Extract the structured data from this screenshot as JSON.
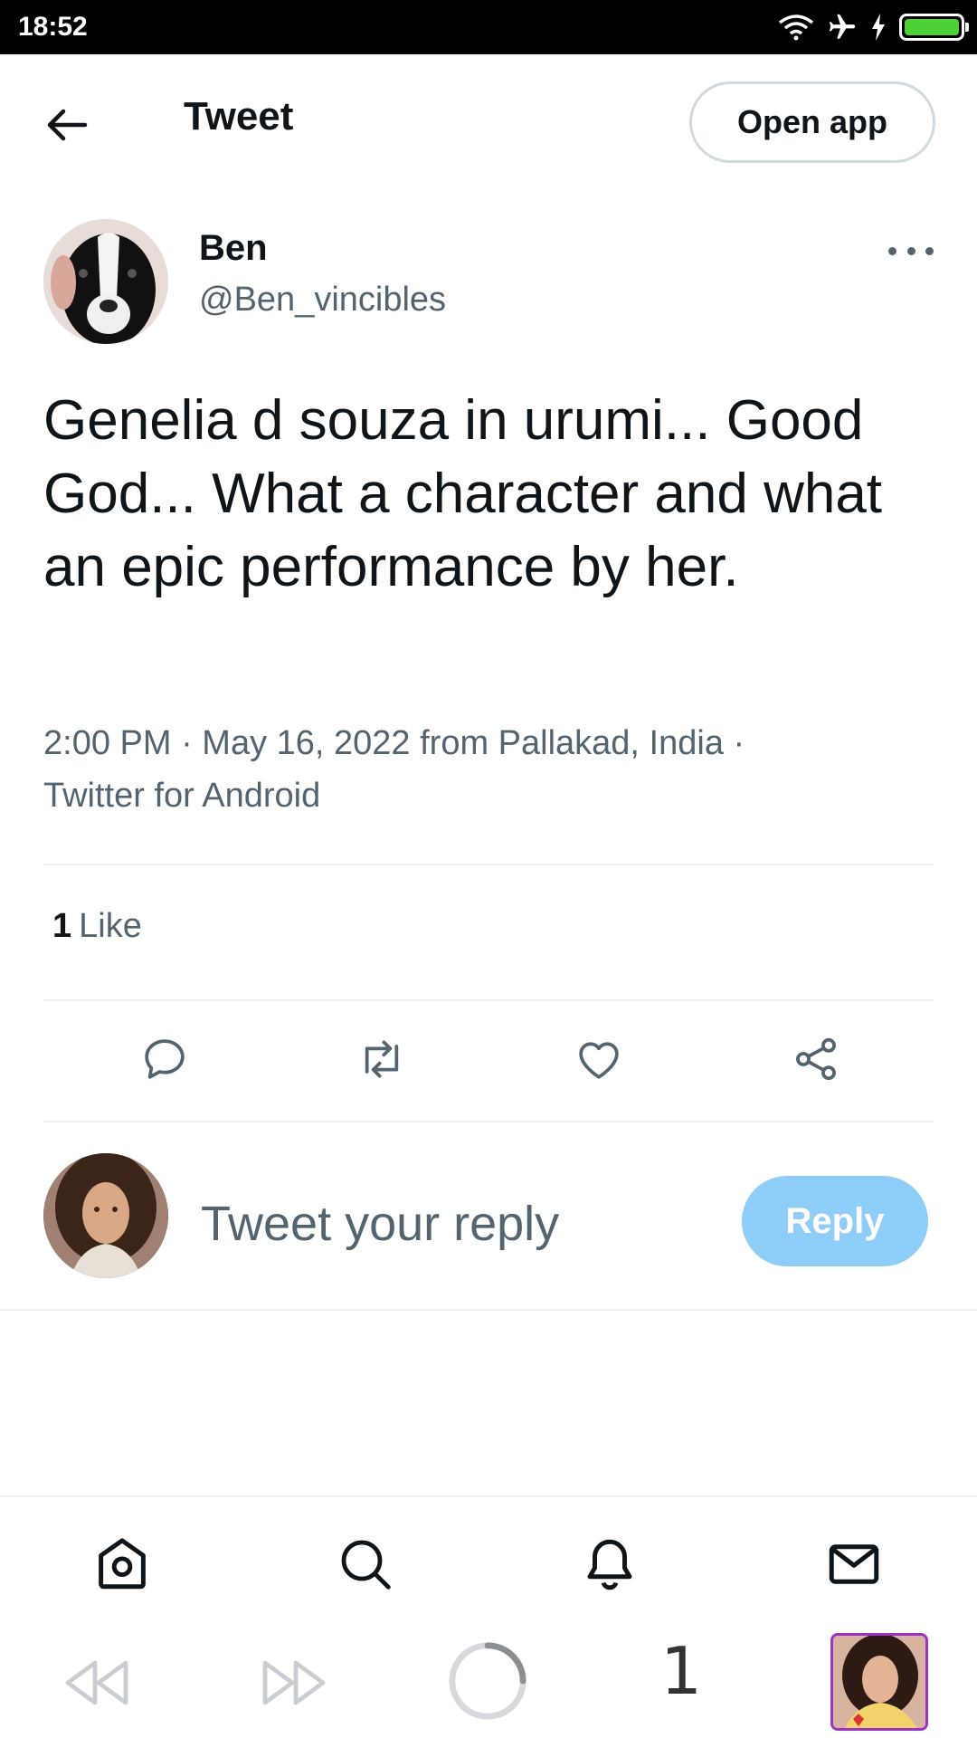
{
  "status_bar": {
    "time": "18:52",
    "icons": [
      "wifi-icon",
      "airplane-icon",
      "charging-icon",
      "battery-icon"
    ],
    "battery_color": "#4cd137"
  },
  "header": {
    "back_icon": "arrow-left-icon",
    "title": "Tweet",
    "open_app_label": "Open app"
  },
  "tweet": {
    "author_name": "Ben",
    "author_handle": "@Ben_vincibles",
    "text": "Genelia d souza in urumi... Good God... What a character and what an epic performance by her.",
    "meta": "2:00 PM · May 16, 2022 from Pallakad, India · Twitter for Android",
    "like_count": "1",
    "like_label": "Like",
    "actions": [
      "reply-icon",
      "retweet-icon",
      "like-icon",
      "share-icon"
    ]
  },
  "reply": {
    "placeholder": "Tweet your reply",
    "button_label": "Reply",
    "button_color": "#8ecdf8"
  },
  "bottom_nav": {
    "items": [
      "home-icon",
      "search-icon",
      "notifications-icon",
      "messages-icon"
    ]
  },
  "browser_bar": {
    "tab_count": "1",
    "buttons": [
      "rewind-icon",
      "fast-forward-icon",
      "loading-spinner-icon"
    ]
  },
  "colors": {
    "text_primary": "#0f1419",
    "text_secondary": "#536471",
    "divider": "#eff3f4"
  }
}
